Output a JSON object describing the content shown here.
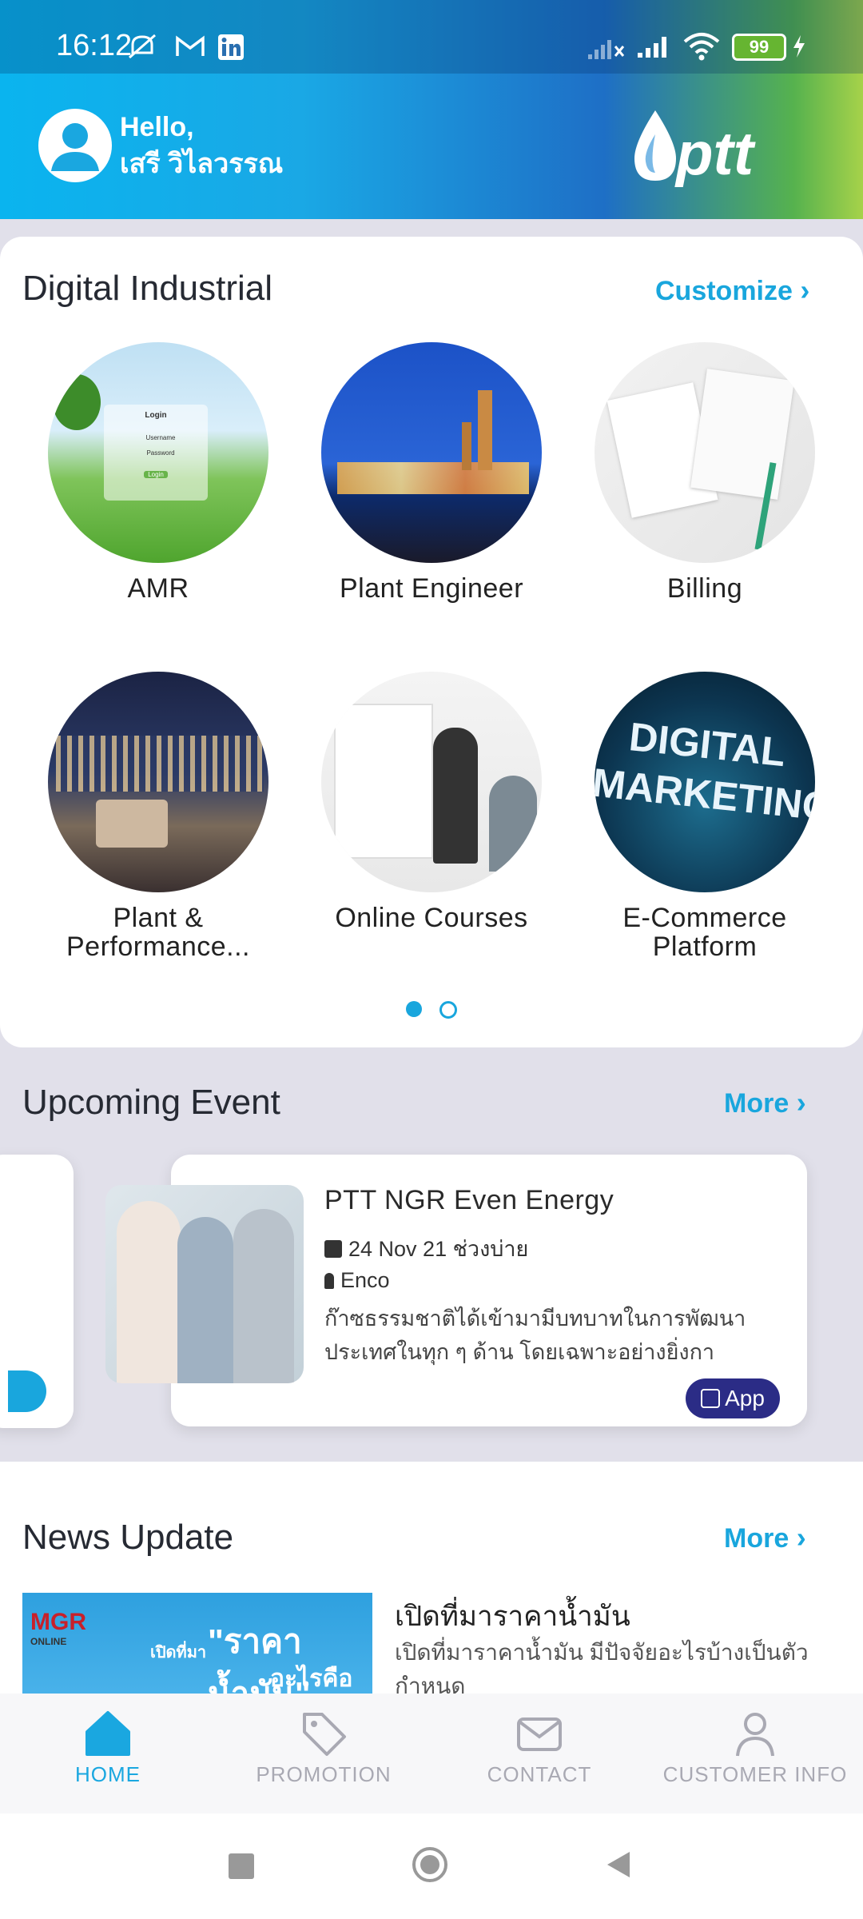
{
  "status_bar": {
    "time": "16:12",
    "battery": "99"
  },
  "header": {
    "greeting": "Hello,",
    "user_name": "เสรี วิไลวรรณ",
    "logo_text": "ptt"
  },
  "digital_industrial": {
    "title": "Digital Industrial",
    "customize_label": "Customize",
    "tiles": [
      {
        "label": "AMR"
      },
      {
        "label": "Plant Engineer"
      },
      {
        "label": "Billing"
      },
      {
        "label": "Plant &\nPerformance..."
      },
      {
        "label": "Online Courses"
      },
      {
        "label": "E-Commerce\nPlatform"
      }
    ],
    "amr_login": {
      "title": "Login",
      "username": "Username",
      "password": "Password",
      "button": "Login"
    },
    "marketing_text": "DIGITAL\nMARKETING"
  },
  "upcoming_event": {
    "title": "Upcoming Event",
    "more_label": "More",
    "event": {
      "title": "PTT NGR Even Energy",
      "date": "24 Nov 21  ช่วงบ่าย",
      "location": "Enco",
      "description": "ก๊าซธรรมชาติได้เข้ามามีบทบาทในการพัฒนาประเทศในทุก ๆ ด้าน โดยเฉพาะอย่างยิ่งการนำม...",
      "badge": "App"
    }
  },
  "news_update": {
    "title": "News Update",
    "more_label": "More",
    "item": {
      "headline": "เปิดที่มาราคาน้ำมัน",
      "summary": "เปิดที่มาราคาน้ำมัน มีปัจจัยอะไรบ้างเป็นตัวกำหนด",
      "thumb_text_1": "เปิดที่มา",
      "thumb_text_2": "\"ราคาน้ำมัน\"",
      "thumb_text_3": "อะไรคือ",
      "thumb_brand": "MGR",
      "thumb_brand_sub": "ONLINE"
    }
  },
  "bottom_nav": [
    {
      "label": "HOME",
      "active": true
    },
    {
      "label": "PROMOTION",
      "active": false
    },
    {
      "label": "CONTACT",
      "active": false
    },
    {
      "label": "CUSTOMER INFO",
      "active": false
    }
  ],
  "colors": {
    "accent": "#19a6dd",
    "active_nav": "#1aa7e0",
    "inactive_nav": "#a9a9b3",
    "badge": "#2b2c86"
  }
}
